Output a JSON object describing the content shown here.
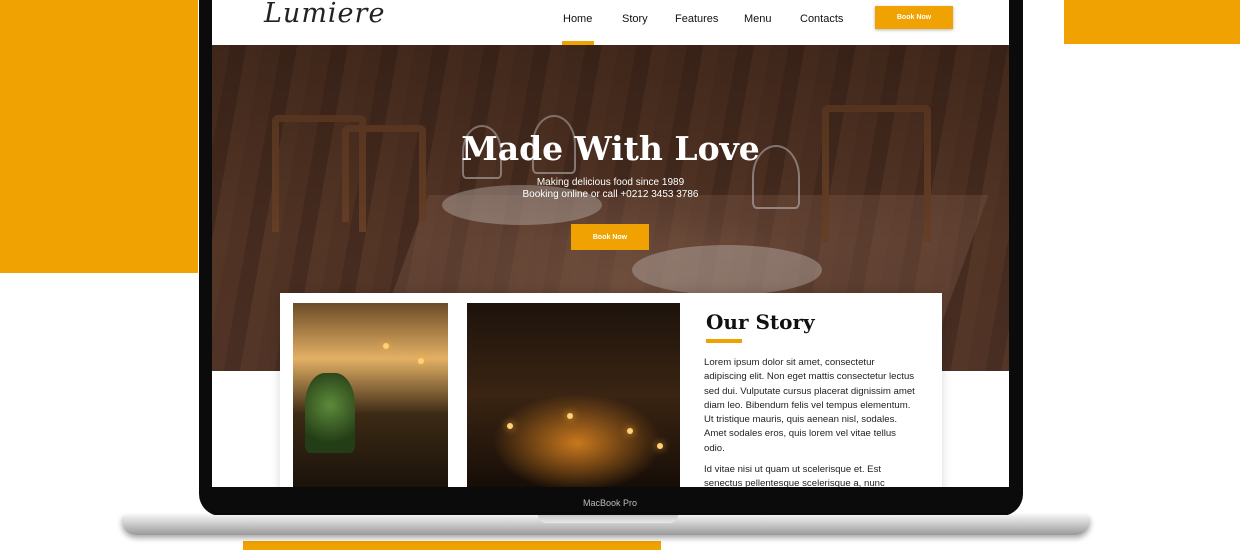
{
  "colors": {
    "accent": "#efa201",
    "dark": "#0b0b0b",
    "text": "#222222"
  },
  "nav": {
    "logo": "Lumiere",
    "links": [
      "Home",
      "Story",
      "Features",
      "Menu",
      "Contacts"
    ],
    "active": "Home",
    "cta": "Book Now"
  },
  "hero": {
    "title": "Made With Love",
    "line1": "Making delicious food since 1989",
    "line2": "Booking online or call +0212 3453 3786",
    "cta": "Book Now"
  },
  "story": {
    "title": "Our Story",
    "p1": "Lorem ipsum dolor sit amet, consectetur adipiscing elit. Non eget mattis consectetur lectus sed dui. Vulputate cursus placerat dignissim amet diam leo. Bibendum felis vel tempus elementum. Ut tristique mauris, quis aenean nisl, sodales. Amet sodales eros, quis lorem vel vitae tellus odio.",
    "p2": "Id vitae nisi ut quam ut scelerisque et. Est senectus pellentesque scelerisque a, nunc"
  },
  "device": {
    "label": "MacBook Pro"
  }
}
